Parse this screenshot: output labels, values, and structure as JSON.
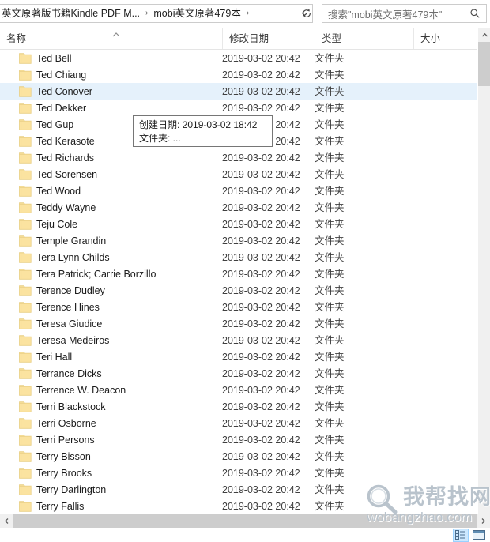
{
  "window": {
    "type": "file-explorer"
  },
  "navbar": {
    "breadcrumbs": [
      {
        "label": "英文原著版书籍Kindle PDF M...",
        "separator": "›"
      },
      {
        "label": "mobi英文原著479本",
        "separator": "›"
      }
    ],
    "dropdown_icon": "chevron-down-icon",
    "refresh_icon": "refresh-icon",
    "search": {
      "placeholder": "搜索\"mobi英文原著479本\"",
      "icon": "search-icon"
    }
  },
  "columns": [
    {
      "key": "name",
      "label": "名称",
      "sorted": "asc"
    },
    {
      "key": "date",
      "label": "修改日期",
      "sorted": ""
    },
    {
      "key": "type",
      "label": "类型",
      "sorted": ""
    },
    {
      "key": "size",
      "label": "大小",
      "sorted": ""
    }
  ],
  "rows": [
    {
      "name": "Ted Bell",
      "date": "2019-03-02 20:42",
      "type": "文件夹",
      "size": "",
      "selected": false
    },
    {
      "name": "Ted Chiang",
      "date": "2019-03-02 20:42",
      "type": "文件夹",
      "size": "",
      "selected": false
    },
    {
      "name": "Ted Conover",
      "date": "2019-03-02 20:42",
      "type": "文件夹",
      "size": "",
      "selected": true
    },
    {
      "name": "Ted Dekker",
      "date": "2019-03-02 20:42",
      "type": "文件夹",
      "size": "",
      "selected": false
    },
    {
      "name": "Ted Gup",
      "date": "2019-03-02 20:42",
      "type": "文件夹",
      "size": "",
      "selected": false
    },
    {
      "name": "Ted Kerasote",
      "date": "2019-03-02 20:42",
      "type": "文件夹",
      "size": "",
      "selected": false
    },
    {
      "name": "Ted Richards",
      "date": "2019-03-02 20:42",
      "type": "文件夹",
      "size": "",
      "selected": false
    },
    {
      "name": "Ted Sorensen",
      "date": "2019-03-02 20:42",
      "type": "文件夹",
      "size": "",
      "selected": false
    },
    {
      "name": "Ted Wood",
      "date": "2019-03-02 20:42",
      "type": "文件夹",
      "size": "",
      "selected": false
    },
    {
      "name": "Teddy Wayne",
      "date": "2019-03-02 20:42",
      "type": "文件夹",
      "size": "",
      "selected": false
    },
    {
      "name": "Teju Cole",
      "date": "2019-03-02 20:42",
      "type": "文件夹",
      "size": "",
      "selected": false
    },
    {
      "name": "Temple Grandin",
      "date": "2019-03-02 20:42",
      "type": "文件夹",
      "size": "",
      "selected": false
    },
    {
      "name": "Tera Lynn Childs",
      "date": "2019-03-02 20:42",
      "type": "文件夹",
      "size": "",
      "selected": false
    },
    {
      "name": "Tera Patrick; Carrie Borzillo",
      "date": "2019-03-02 20:42",
      "type": "文件夹",
      "size": "",
      "selected": false
    },
    {
      "name": "Terence Dudley",
      "date": "2019-03-02 20:42",
      "type": "文件夹",
      "size": "",
      "selected": false
    },
    {
      "name": "Terence Hines",
      "date": "2019-03-02 20:42",
      "type": "文件夹",
      "size": "",
      "selected": false
    },
    {
      "name": "Teresa Giudice",
      "date": "2019-03-02 20:42",
      "type": "文件夹",
      "size": "",
      "selected": false
    },
    {
      "name": "Teresa Medeiros",
      "date": "2019-03-02 20:42",
      "type": "文件夹",
      "size": "",
      "selected": false
    },
    {
      "name": "Teri Hall",
      "date": "2019-03-02 20:42",
      "type": "文件夹",
      "size": "",
      "selected": false
    },
    {
      "name": "Terrance Dicks",
      "date": "2019-03-02 20:42",
      "type": "文件夹",
      "size": "",
      "selected": false
    },
    {
      "name": "Terrence W. Deacon",
      "date": "2019-03-02 20:42",
      "type": "文件夹",
      "size": "",
      "selected": false
    },
    {
      "name": "Terri Blackstock",
      "date": "2019-03-02 20:42",
      "type": "文件夹",
      "size": "",
      "selected": false
    },
    {
      "name": "Terri Osborne",
      "date": "2019-03-02 20:42",
      "type": "文件夹",
      "size": "",
      "selected": false
    },
    {
      "name": "Terri Persons",
      "date": "2019-03-02 20:42",
      "type": "文件夹",
      "size": "",
      "selected": false
    },
    {
      "name": "Terry Bisson",
      "date": "2019-03-02 20:42",
      "type": "文件夹",
      "size": "",
      "selected": false
    },
    {
      "name": "Terry Brooks",
      "date": "2019-03-02 20:42",
      "type": "文件夹",
      "size": "",
      "selected": false
    },
    {
      "name": "Terry Darlington",
      "date": "2019-03-02 20:42",
      "type": "文件夹",
      "size": "",
      "selected": false
    },
    {
      "name": "Terry Fallis",
      "date": "2019-03-02 20:42",
      "type": "文件夹",
      "size": "",
      "selected": false
    }
  ],
  "tooltip": {
    "line1": "创建日期: 2019-03-02 18:42",
    "line2": "文件夹: ..."
  },
  "statusbar": {
    "view_details_icon": "details-view-icon",
    "view_large_icons_icon": "large-icons-view-icon"
  },
  "watermark": {
    "icon": "magnifier-icon",
    "title": "我帮找网",
    "domain": "wobangzhao.com"
  },
  "colors": {
    "selection": "#e5f1fb",
    "folder": "#fbe5a0",
    "scroll_thumb": "#cdcdcd",
    "view_active": "#cce8ff"
  }
}
